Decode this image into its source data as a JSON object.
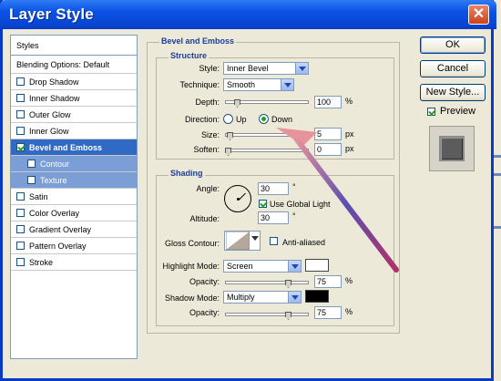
{
  "window": {
    "title": "Layer Style",
    "close_glyph": "✕"
  },
  "styles_list": {
    "header": "Styles",
    "blending": "Blending Options: Default",
    "items": [
      {
        "label": "Drop Shadow",
        "checked": false
      },
      {
        "label": "Inner Shadow",
        "checked": false
      },
      {
        "label": "Outer Glow",
        "checked": false
      },
      {
        "label": "Inner Glow",
        "checked": false
      },
      {
        "label": "Bevel and Emboss",
        "checked": true,
        "selected": true
      },
      {
        "label": "Contour",
        "checked": false,
        "sub": true
      },
      {
        "label": "Texture",
        "checked": false,
        "sub": true
      },
      {
        "label": "Satin",
        "checked": false
      },
      {
        "label": "Color Overlay",
        "checked": false
      },
      {
        "label": "Gradient Overlay",
        "checked": false
      },
      {
        "label": "Pattern Overlay",
        "checked": false
      },
      {
        "label": "Stroke",
        "checked": false
      }
    ]
  },
  "bevel": {
    "section_title": "Bevel and Emboss",
    "structure": {
      "title": "Structure",
      "style_label": "Style:",
      "style_value": "Inner Bevel",
      "technique_label": "Technique:",
      "technique_value": "Smooth",
      "depth_label": "Depth:",
      "depth_value": "100",
      "depth_unit": "%",
      "direction_label": "Direction:",
      "direction_up": "Up",
      "direction_down": "Down",
      "size_label": "Size:",
      "size_value": "5",
      "size_unit": "px",
      "soften_label": "Soften:",
      "soften_value": "0",
      "soften_unit": "px"
    },
    "shading": {
      "title": "Shading",
      "angle_label": "Angle:",
      "angle_value": "30",
      "global_light": "Use Global Light",
      "altitude_label": "Altitude:",
      "altitude_value": "30",
      "gloss_label": "Gloss Contour:",
      "anti_aliased": "Anti-aliased",
      "highlight_label": "Highlight Mode:",
      "highlight_value": "Screen",
      "highlight_opacity_label": "Opacity:",
      "highlight_opacity": "75",
      "highlight_color": "#ffffff",
      "shadow_label": "Shadow Mode:",
      "shadow_value": "Multiply",
      "shadow_opacity_label": "Opacity:",
      "shadow_opacity": "75",
      "shadow_color": "#000000",
      "pct": "%",
      "degree": "°"
    }
  },
  "buttons": {
    "ok": "OK",
    "cancel": "Cancel",
    "new_style": "New Style...",
    "preview": "Preview"
  },
  "annotation": {
    "arrow_color": "#7a2f8f",
    "arrow_head": "#e7939c"
  }
}
